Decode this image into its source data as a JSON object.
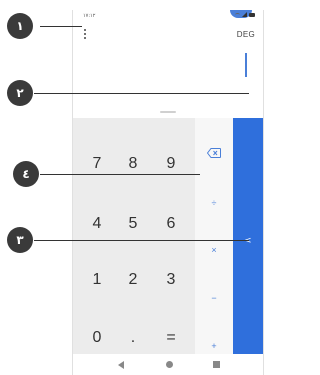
{
  "status_bar": {
    "time": "١٧:١٢"
  },
  "header": {
    "angle_mode": "DEG"
  },
  "keypad": {
    "rows": [
      [
        "7",
        "8",
        "9"
      ],
      [
        "4",
        "5",
        "6"
      ],
      [
        "1",
        "2",
        "3"
      ],
      [
        "0",
        ".",
        "="
      ]
    ]
  },
  "operators": [
    "÷",
    "×",
    "−",
    "+"
  ],
  "callouts": [
    "١",
    "٢",
    "٣",
    "٤"
  ],
  "colors": {
    "accent": "#2f6fdc",
    "keypad_bg": "#ececec"
  },
  "icons": {
    "overflow": "overflow-menu-icon",
    "backspace": "backspace-icon",
    "drawer": "chevron-left-icon"
  }
}
